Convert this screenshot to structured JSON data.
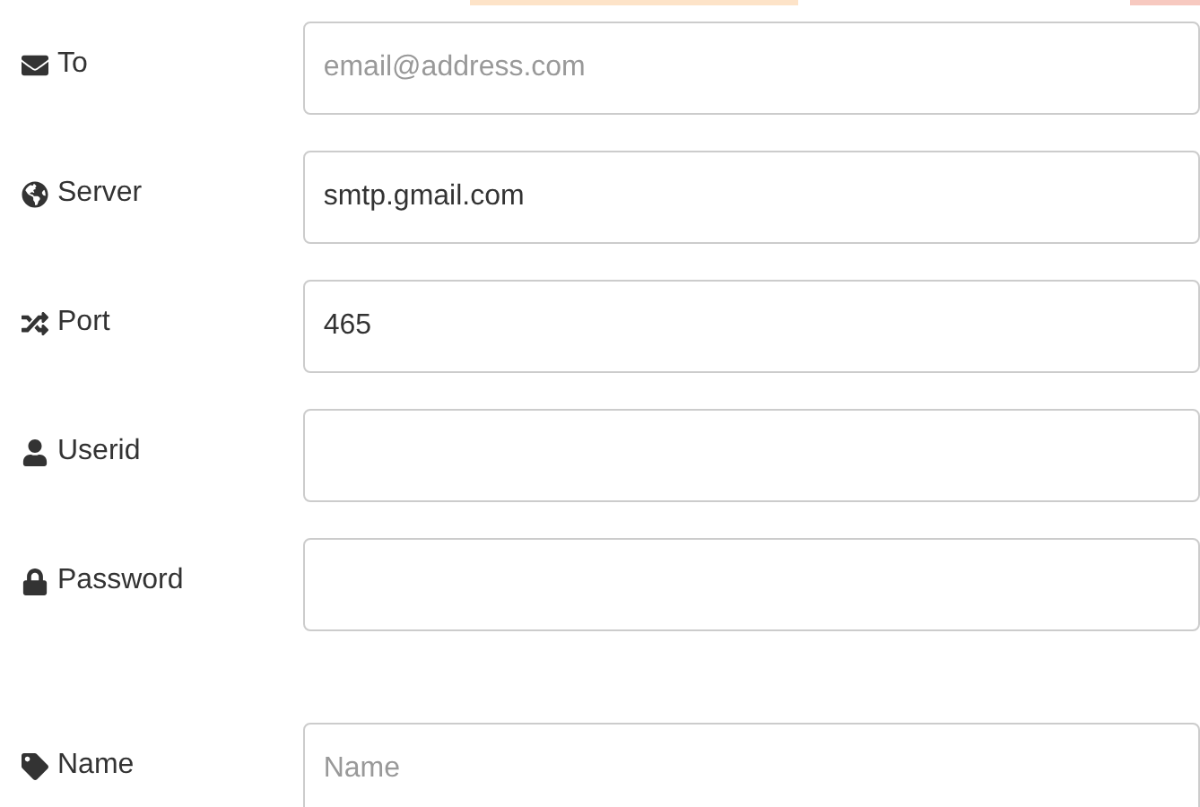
{
  "fields": [
    {
      "label": "To",
      "placeholder": "email@address.com"
    },
    {
      "label": "Server",
      "value": "smtp.gmail.com"
    },
    {
      "label": "Port",
      "value": "465"
    },
    {
      "label": "Userid"
    },
    {
      "label": "Password"
    }
  ],
  "name_field": {
    "label": "Name",
    "placeholder": "Name"
  }
}
